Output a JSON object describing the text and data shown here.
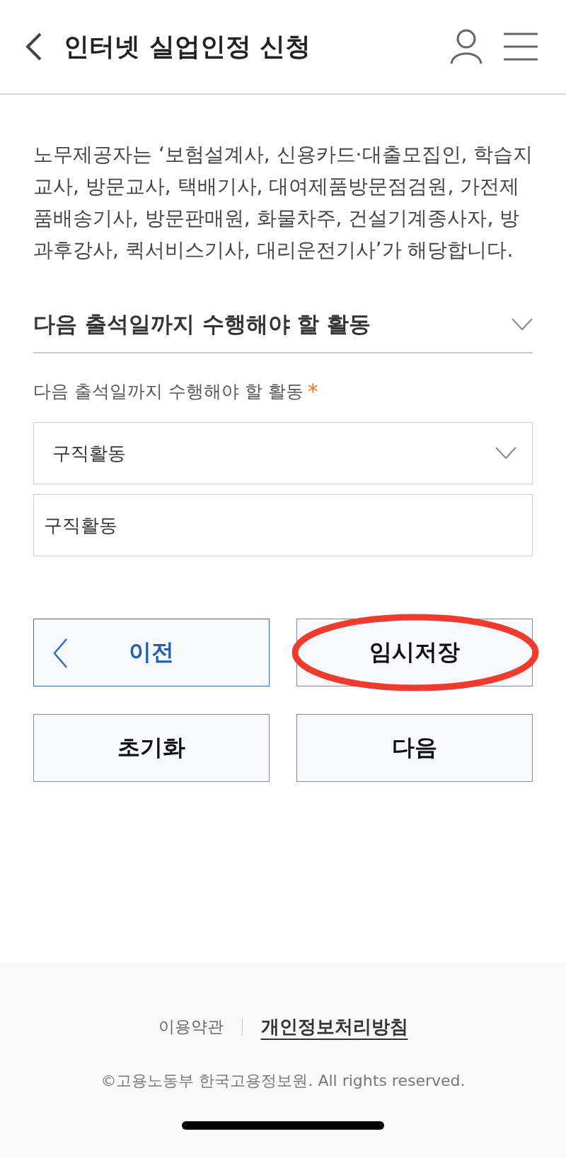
{
  "header": {
    "title": "인터넷 실업인정 신청"
  },
  "paragraph": "노무제공자는 ‘보험설계사, 신용카드·대출모집인, 학습지교사, 방문교사, 택배기사, 대여제품방문점검원, 가전제품배송기사, 방문판매원, 화물차주, 건설기계종사자, 방과후강사, 퀵서비스기사, 대리운전기사’가 해당합니다.",
  "section": {
    "title": "다음 출석일까지 수행해야 할 활동",
    "expanded": true,
    "field_label": "다음 출석일까지 수행해야 할 활동",
    "required_mark": "*",
    "select": {
      "value": "구직활동"
    },
    "input": {
      "value": "구직활동"
    }
  },
  "buttons": [
    {
      "label": "이전",
      "kind": "prev",
      "highlighted": false
    },
    {
      "label": "임시저장",
      "kind": "plain",
      "highlighted": true
    },
    {
      "label": "초기화",
      "kind": "plain",
      "highlighted": false
    },
    {
      "label": "다음",
      "kind": "plain",
      "highlighted": false
    }
  ],
  "footer": {
    "links": [
      {
        "label": "이용약관",
        "emphasized": false
      },
      {
        "label": "개인정보처리방침",
        "emphasized": true
      }
    ],
    "copyright": "©고용노동부 한국고용정보원. All rights reserved."
  }
}
